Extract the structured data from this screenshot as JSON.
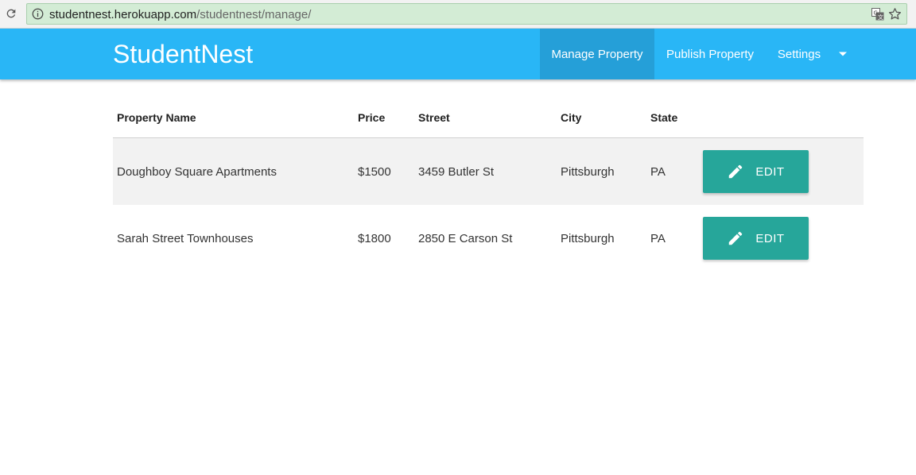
{
  "browser": {
    "url_host": "studentnest.herokuapp.com",
    "url_path": "/studentnest/manage/",
    "icons": [
      "reload-icon",
      "info-icon",
      "translate-icon",
      "star-icon"
    ]
  },
  "navbar": {
    "brand": "StudentNest",
    "items": [
      {
        "label": "Manage Property",
        "active": true
      },
      {
        "label": "Publish Property",
        "active": false
      },
      {
        "label": "Settings",
        "active": false
      }
    ],
    "colors": {
      "bar": "#29b6f6",
      "active": "#259fd8"
    }
  },
  "table": {
    "headers": [
      "Property Name",
      "Price",
      "Street",
      "City",
      "State"
    ],
    "rows": [
      {
        "name": "Doughboy Square Apartments",
        "price": "$1500",
        "street": "3459 Butler St",
        "city": "Pittsburgh",
        "state": "PA",
        "action": "EDIT"
      },
      {
        "name": "Sarah Street Townhouses",
        "price": "$1800",
        "street": "2850 E Carson St",
        "city": "Pittsburgh",
        "state": "PA",
        "action": "EDIT"
      }
    ],
    "button_color": "#26a69a"
  }
}
